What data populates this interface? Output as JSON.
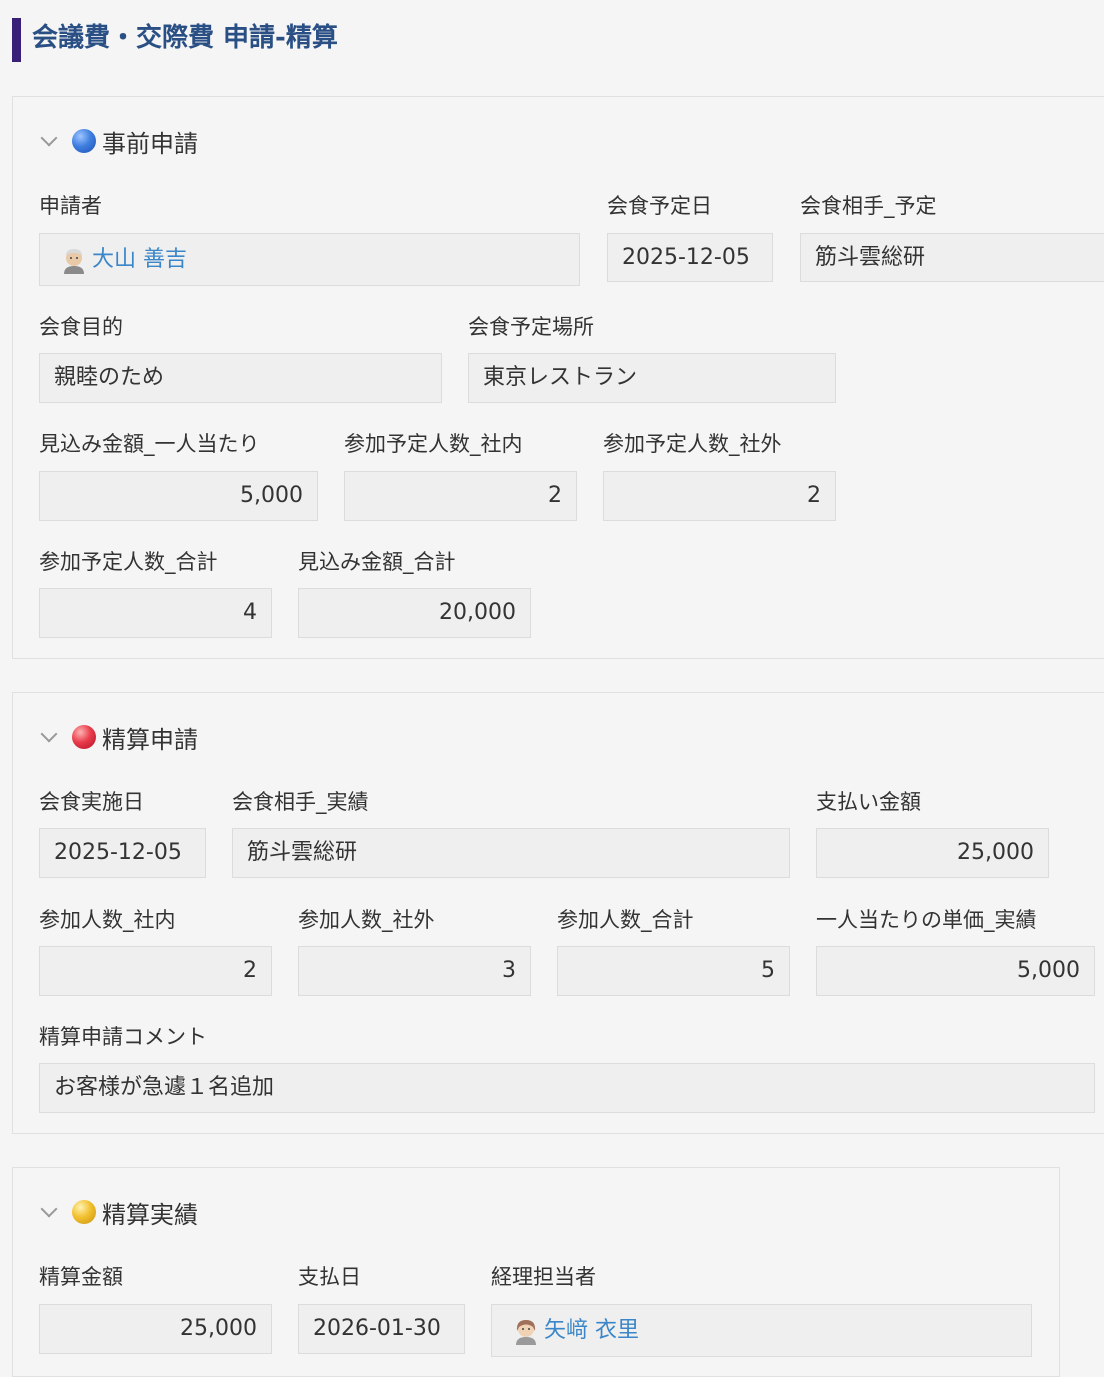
{
  "page": {
    "title": "会議費・交際費 申請-精算"
  },
  "pre": {
    "title": "事前申請",
    "applicant": {
      "label": "申請者",
      "value": "大山 善吉"
    },
    "date": {
      "label": "会食予定日",
      "value": "2025-12-05"
    },
    "partner": {
      "label": "会食相手_予定",
      "value": "筋斗雲総研"
    },
    "purpose": {
      "label": "会食目的",
      "value": "親睦のため"
    },
    "place": {
      "label": "会食予定場所",
      "value": "東京レストラン"
    },
    "per_person": {
      "label": "見込み金額_一人当たり",
      "value": "5,000"
    },
    "internal": {
      "label": "参加予定人数_社内",
      "value": "2"
    },
    "external": {
      "label": "参加予定人数_社外",
      "value": "2"
    },
    "total_people": {
      "label": "参加予定人数_合計",
      "value": "4"
    },
    "total_amount": {
      "label": "見込み金額_合計",
      "value": "20,000"
    }
  },
  "settle": {
    "title": "精算申請",
    "date": {
      "label": "会食実施日",
      "value": "2025-12-05"
    },
    "partner": {
      "label": "会食相手_実績",
      "value": "筋斗雲総研"
    },
    "paid": {
      "label": "支払い金額",
      "value": "25,000"
    },
    "internal": {
      "label": "参加人数_社内",
      "value": "2"
    },
    "external": {
      "label": "参加人数_社外",
      "value": "3"
    },
    "total": {
      "label": "参加人数_合計",
      "value": "5"
    },
    "unit": {
      "label": "一人当たりの単価_実績",
      "value": "5,000"
    },
    "comment": {
      "label": "精算申請コメント",
      "value": "お客様が急遽１名追加"
    }
  },
  "result": {
    "title": "精算実績",
    "amount": {
      "label": "精算金額",
      "value": "25,000"
    },
    "pay_date": {
      "label": "支払日",
      "value": "2026-01-30"
    },
    "accountant": {
      "label": "経理担当者",
      "value": "矢﨑 衣里"
    }
  },
  "icons": {
    "section_dots": {
      "pre": "#3f7fe0",
      "settle": "#e83c4a",
      "result": "#f2c02f"
    },
    "title_accent": "#3a1f78",
    "title_color": "#2a4f84",
    "link_color": "#3a86c8"
  }
}
